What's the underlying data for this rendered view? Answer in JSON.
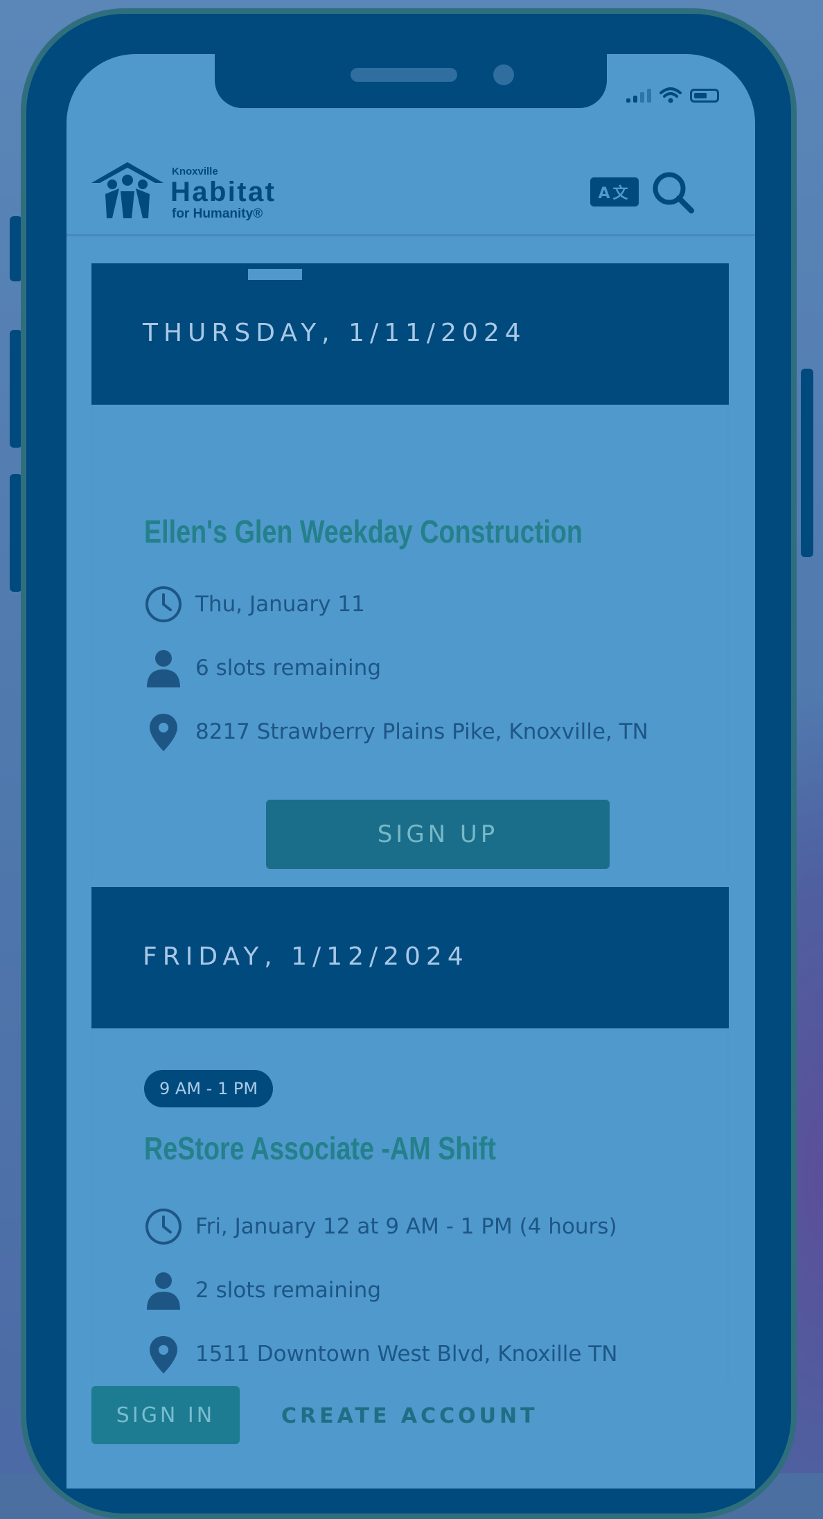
{
  "status_bar": {
    "signal": "signal-icon",
    "wifi": "wifi-icon",
    "battery": "battery-icon"
  },
  "header": {
    "logo": {
      "line1": "Knoxville",
      "line2": "Habitat",
      "line3": "for Humanity®"
    },
    "translate_label": "A文",
    "search_icon": "search-icon"
  },
  "days": [
    {
      "label": "THURSDAY, 1/11/2024",
      "events": [
        {
          "title": "Ellen's Glen Weekday Construction",
          "when": "Thu, January 11",
          "slots": "6 slots remaining",
          "location": "8217 Strawberry Plains Pike, Knoxville, TN",
          "signup_label": "SIGN UP"
        }
      ]
    },
    {
      "label": "FRIDAY, 1/12/2024",
      "events": [
        {
          "time_pill": "9 AM - 1 PM",
          "title": "ReStore Associate -AM Shift",
          "when": "Fri, January 12 at 9 AM - 1 PM (4 hours)",
          "slots": "2 slots remaining",
          "location": "1511 Downtown West Blvd, Knoxille TN"
        }
      ]
    }
  ],
  "bottom_bar": {
    "sign_in_label": "SIGN IN",
    "create_account_label": "CREATE ACCOUNT"
  },
  "colors": {
    "frame": "#004a7d",
    "screen": "#5099cc",
    "accent_teal": "#24808a",
    "button": "#1a6e8a"
  }
}
